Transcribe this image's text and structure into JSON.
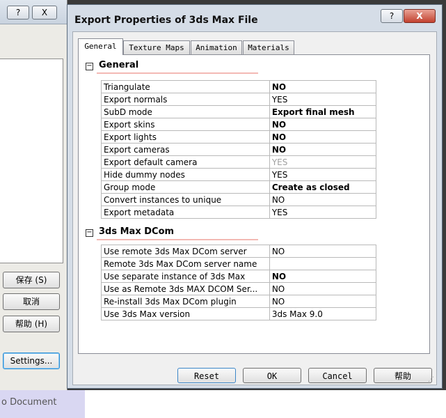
{
  "background_window": {
    "help_label": "?",
    "close_label": "X",
    "save_label": "保存 (S)",
    "cancel_label": "取消",
    "help_button_label": "帮助 (H)",
    "settings_label": "Settings...",
    "status_text": "o Document"
  },
  "dialog": {
    "title": "Export Properties of 3ds Max File",
    "help_label": "?",
    "close_label": "X",
    "tabs": [
      {
        "label": "General",
        "active": true
      },
      {
        "label": "Texture Maps",
        "active": false
      },
      {
        "label": "Animation",
        "active": false
      },
      {
        "label": "Materials",
        "active": false
      }
    ],
    "sections": [
      {
        "title": "General",
        "toggle": "−",
        "rows": [
          {
            "key": "Triangulate",
            "value": "NO",
            "style": "bold"
          },
          {
            "key": "Export normals",
            "value": "YES",
            "style": "normal"
          },
          {
            "key": "SubD mode",
            "value": "Export final mesh",
            "style": "bold"
          },
          {
            "key": "Export skins",
            "value": "NO",
            "style": "bold"
          },
          {
            "key": "Export lights",
            "value": "NO",
            "style": "bold"
          },
          {
            "key": "Export cameras",
            "value": "NO",
            "style": "bold"
          },
          {
            "key": "Export default camera",
            "value": "YES",
            "style": "grey"
          },
          {
            "key": "Hide dummy nodes",
            "value": "YES",
            "style": "normal"
          },
          {
            "key": "Group mode",
            "value": "Create as closed",
            "style": "bold"
          },
          {
            "key": "Convert instances to unique",
            "value": "NO",
            "style": "normal"
          },
          {
            "key": "Export metadata",
            "value": "YES",
            "style": "normal"
          }
        ]
      },
      {
        "title": "3ds Max DCom",
        "toggle": "−",
        "rows": [
          {
            "key": "Use remote 3ds Max DCom server",
            "value": "NO",
            "style": "normal"
          },
          {
            "key": "Remote 3ds Max DCom server name",
            "value": "",
            "style": "normal"
          },
          {
            "key": "Use separate instance of 3ds Max",
            "value": "NO",
            "style": "bold"
          },
          {
            "key": "Use as Remote 3ds MAX DCOM Ser...",
            "value": "NO",
            "style": "normal"
          },
          {
            "key": "Re-install 3ds Max DCom plugin",
            "value": "NO",
            "style": "normal"
          },
          {
            "key": "Use 3ds Max version",
            "value": "3ds Max 9.0",
            "style": "normal"
          }
        ]
      }
    ],
    "buttons": {
      "reset": "Reset",
      "ok": "OK",
      "cancel": "Cancel",
      "help": "帮助"
    }
  }
}
